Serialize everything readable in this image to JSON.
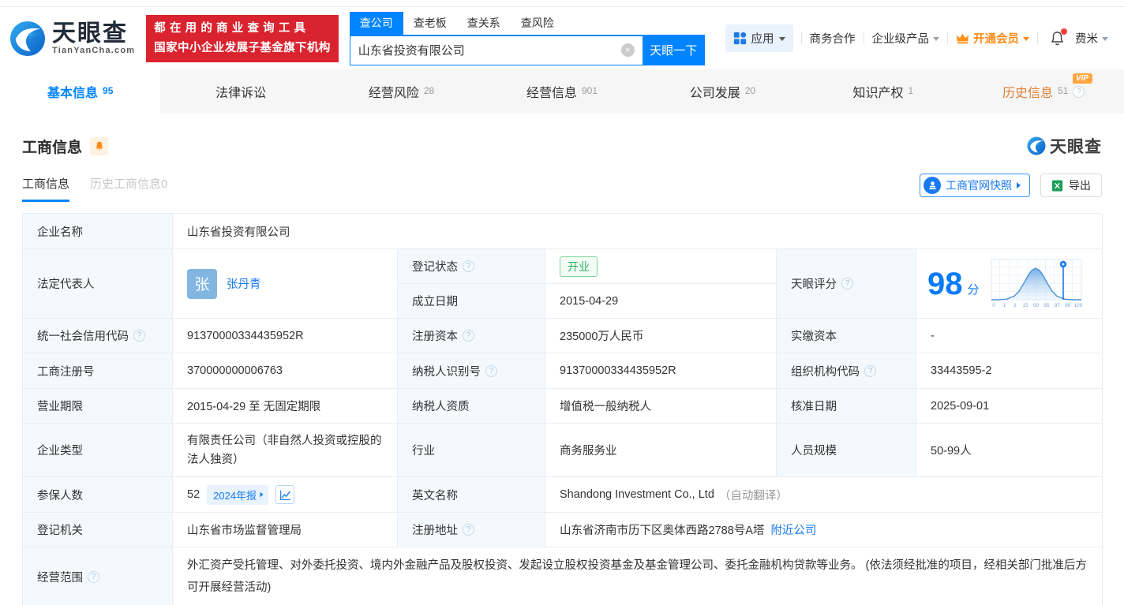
{
  "colors": {
    "accent_blue": "#0084ff",
    "promo_red": "#d9232e",
    "vip_orange": "#ffa63e",
    "status_green": "#2daf5e",
    "score_blue": "#0a7bf5"
  },
  "icons": {
    "help": "?",
    "close": "×"
  },
  "header": {
    "brand": "天眼查",
    "brand_domain": "TianYanCha.com",
    "promo_line1": "都在用的商业查询工具",
    "promo_line2": "国家中小企业发展子基金旗下机构",
    "search_tabs": [
      {
        "label": "查公司"
      },
      {
        "label": "查老板"
      },
      {
        "label": "查关系"
      },
      {
        "label": "查风险"
      }
    ],
    "search_value": "山东省投资有限公司",
    "search_button": "天眼一下",
    "nav_apps": "应用",
    "nav_cooperation": "商务合作",
    "nav_enterprise": "企业级产品",
    "nav_vip": "开通会员",
    "nav_user": "费米"
  },
  "tabs": [
    {
      "label": "基本信息",
      "count": "95"
    },
    {
      "label": "法律诉讼",
      "count": ""
    },
    {
      "label": "经营风险",
      "count": "28"
    },
    {
      "label": "经营信息",
      "count": "901"
    },
    {
      "label": "公司发展",
      "count": "20"
    },
    {
      "label": "知识产权",
      "count": "1"
    },
    {
      "label": "历史信息",
      "count": "51",
      "vip": "VIP"
    }
  ],
  "section": {
    "title": "工商信息",
    "watermark_brand": "天眼查",
    "subtab_active": "工商信息",
    "subtab_history": "历史工商信息0",
    "snapshot_button": "工商官网快照",
    "export_button": "导出"
  },
  "table": {
    "company_name_label": "企业名称",
    "company_name": "山东省投资有限公司",
    "legal_rep_label": "法定代表人",
    "legal_rep_avatar": "张",
    "legal_rep_name": "张丹青",
    "reg_status_label": "登记状态",
    "reg_status": "开业",
    "establish_label": "成立日期",
    "establish_date": "2015-04-29",
    "score_label": "天眼评分",
    "score_value": "98",
    "score_unit": "分",
    "score_axis": [
      "0",
      "1",
      "3",
      "15",
      "50",
      "85",
      "97",
      "99",
      "100"
    ],
    "credit_code_label": "统一社会信用代码",
    "credit_code": "91370000334435952R",
    "reg_capital_label": "注册资本",
    "reg_capital": "235000万人民币",
    "paid_capital_label": "实缴资本",
    "paid_capital": "-",
    "reg_number_label": "工商注册号",
    "reg_number": "370000000006763",
    "taxpayer_id_label": "纳税人识别号",
    "taxpayer_id": "91370000334435952R",
    "org_code_label": "组织机构代码",
    "org_code": "33443595-2",
    "business_term_label": "营业期限",
    "business_term": "2015-04-29 至 无固定期限",
    "taxpayer_quality_label": "纳税人资质",
    "taxpayer_quality": "增值税一般纳税人",
    "approval_date_label": "核准日期",
    "approval_date": "2025-09-01",
    "company_type_label": "企业类型",
    "company_type": "有限责任公司（非自然人投资或控股的法人独资）",
    "industry_label": "行业",
    "industry": "商务服务业",
    "staff_size_label": "人员规模",
    "staff_size": "50-99人",
    "insured_label": "参保人数",
    "insured_count": "52",
    "insured_report_badge": "2024年报",
    "english_name_label": "英文名称",
    "english_name": "Shandong Investment Co., Ltd",
    "english_name_note": "（自动翻译）",
    "registry_label": "登记机关",
    "registry": "山东省市场监督管理局",
    "address_label": "注册地址",
    "address": "山东省济南市历下区奥体西路2788号A塔",
    "address_nearby": "附近公司",
    "scope_label": "经营范围",
    "scope": "外汇资产受托管理、对外委托投资、境内外金融产品及股权投资、发起设立股权投资基金及基金管理公司、委托金融机构贷款等业务。 (依法须经批准的项目，经相关部门批准后方可开展经营活动)"
  }
}
